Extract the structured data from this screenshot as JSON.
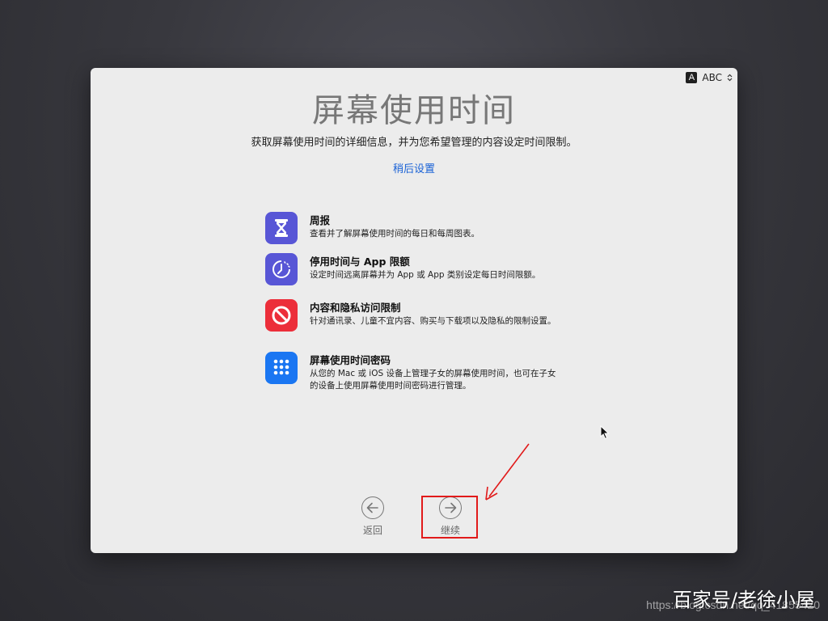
{
  "input_menu": {
    "badge": "A",
    "label": "ABC",
    "icon": "chevron-updown-icon"
  },
  "title": "屏幕使用时间",
  "subtitle": "获取屏幕使用时间的详细信息，并为您希望管理的内容设定时间限制。",
  "later_link": "稍后设置",
  "features": [
    {
      "icon": "hourglass-icon",
      "color": "#5856d6",
      "title": "周报",
      "desc": "查看并了解屏幕使用时间的每日和每周图表。"
    },
    {
      "icon": "downtime-icon",
      "color": "#5856d6",
      "title": "停用时间与 App 限额",
      "desc": "设定时间远离屏幕并为 App 或 App 类别设定每日时间限额。"
    },
    {
      "icon": "no-entry-icon",
      "color": "#ec2e3a",
      "title": "内容和隐私访问限制",
      "desc": "针对通讯录、儿童不宜内容、购买与下载项以及隐私的限制设置。"
    },
    {
      "icon": "keypad-icon",
      "color": "#1a76f2",
      "title": "屏幕使用时间密码",
      "desc": "从您的 Mac 或 iOS 设备上管理子女的屏幕使用时间，也可在子女的设备上使用屏幕使用时间密码进行管理。"
    }
  ],
  "nav": {
    "back_label": "返回",
    "continue_label": "继续"
  },
  "watermark": {
    "main": "百家号/老徐小屋",
    "url": "https://blog.csdn.net/qq_41855420"
  },
  "colors": {
    "link": "#1a62d6",
    "annotation": "#e11a1a"
  }
}
